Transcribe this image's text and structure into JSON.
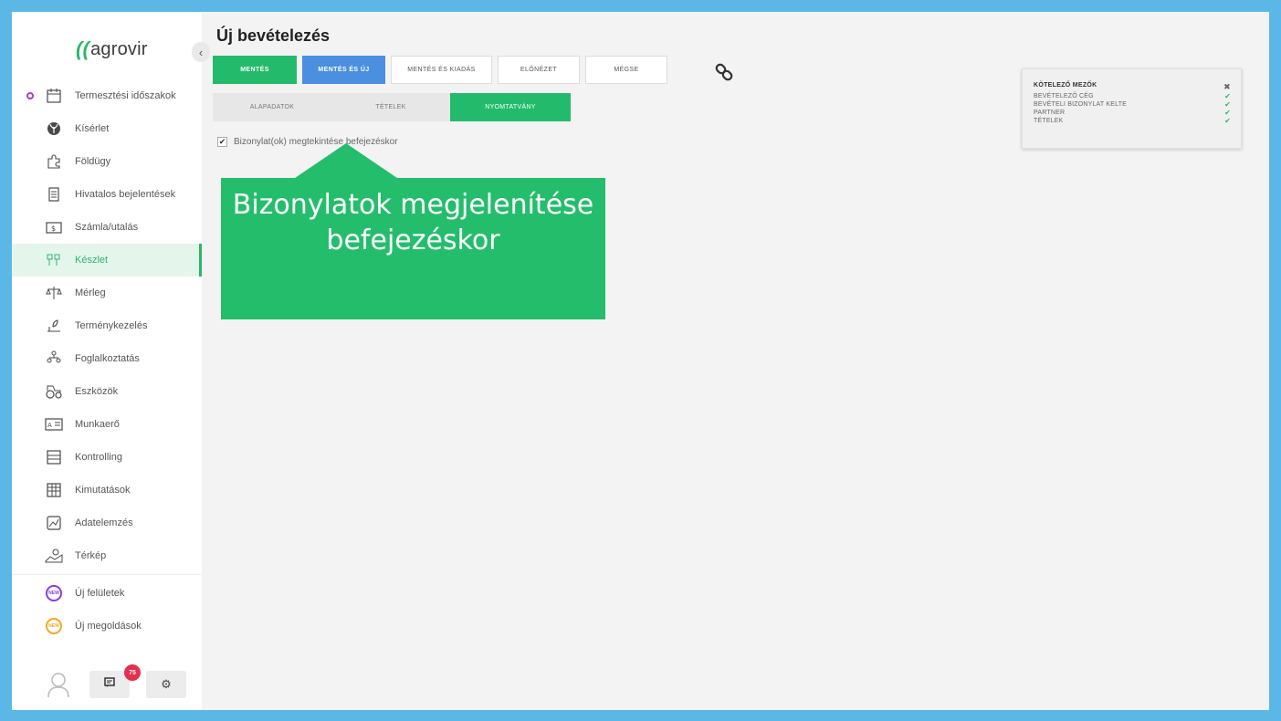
{
  "app": {
    "logo_text": "agrovir"
  },
  "sidebar": {
    "items": [
      {
        "label": "Termesztési időszakok",
        "icon": "calendar-icon"
      },
      {
        "label": "Kísérlet",
        "icon": "seedling-icon"
      },
      {
        "label": "Földügy",
        "icon": "puzzle-icon"
      },
      {
        "label": "Hivatalos bejelentések",
        "icon": "document-icon"
      },
      {
        "label": "Számla/utalás",
        "icon": "invoice-icon"
      },
      {
        "label": "Készlet",
        "icon": "stock-icon"
      },
      {
        "label": "Mérleg",
        "icon": "scale-icon"
      },
      {
        "label": "Terménykezelés",
        "icon": "crop-handling-icon"
      },
      {
        "label": "Foglalkoztatás",
        "icon": "employment-icon"
      },
      {
        "label": "Eszközök",
        "icon": "tractor-icon"
      },
      {
        "label": "Munkaerő",
        "icon": "id-card-icon"
      },
      {
        "label": "Kontrolling",
        "icon": "controlling-icon"
      },
      {
        "label": "Kimutatások",
        "icon": "table-icon"
      },
      {
        "label": "Adatelemzés",
        "icon": "chart-icon"
      },
      {
        "label": "Térkép",
        "icon": "map-icon"
      }
    ],
    "new_items": [
      {
        "label": "Új felületek",
        "badge": "NEW"
      },
      {
        "label": "Új megoldások",
        "badge": "NEW"
      }
    ],
    "active_index": 5,
    "chat_count": "75"
  },
  "main": {
    "title": "Új bevételezés",
    "toolbar": {
      "save": "MENTÉS",
      "save_new": "MENTÉS ÉS ÚJ",
      "save_issue": "MENTÉS ÉS KIADÁS",
      "preview": "ELŐNÉZET",
      "cancel": "MÉGSE"
    },
    "tabs": [
      "ALAPADATOK",
      "TÉTELEK",
      "NYOMTATVÁNY"
    ],
    "checkbox_label": "Bizonylat(ok) megtekintése befejezéskor",
    "callout": "Bizonylatok megjelenítése befejezéskor"
  },
  "required_panel": {
    "title": "KÖTELEZŐ MEZŐK",
    "fields": [
      "BEVÉTELEZŐ CÉG",
      "BEVÉTELI BIZONYLAT KELTE",
      "PARTNER",
      "TÉTELEK"
    ]
  },
  "colors": {
    "accent_green": "#23bb6b",
    "accent_blue": "#4a8fe0",
    "frame_blue": "#5bb8e6"
  }
}
